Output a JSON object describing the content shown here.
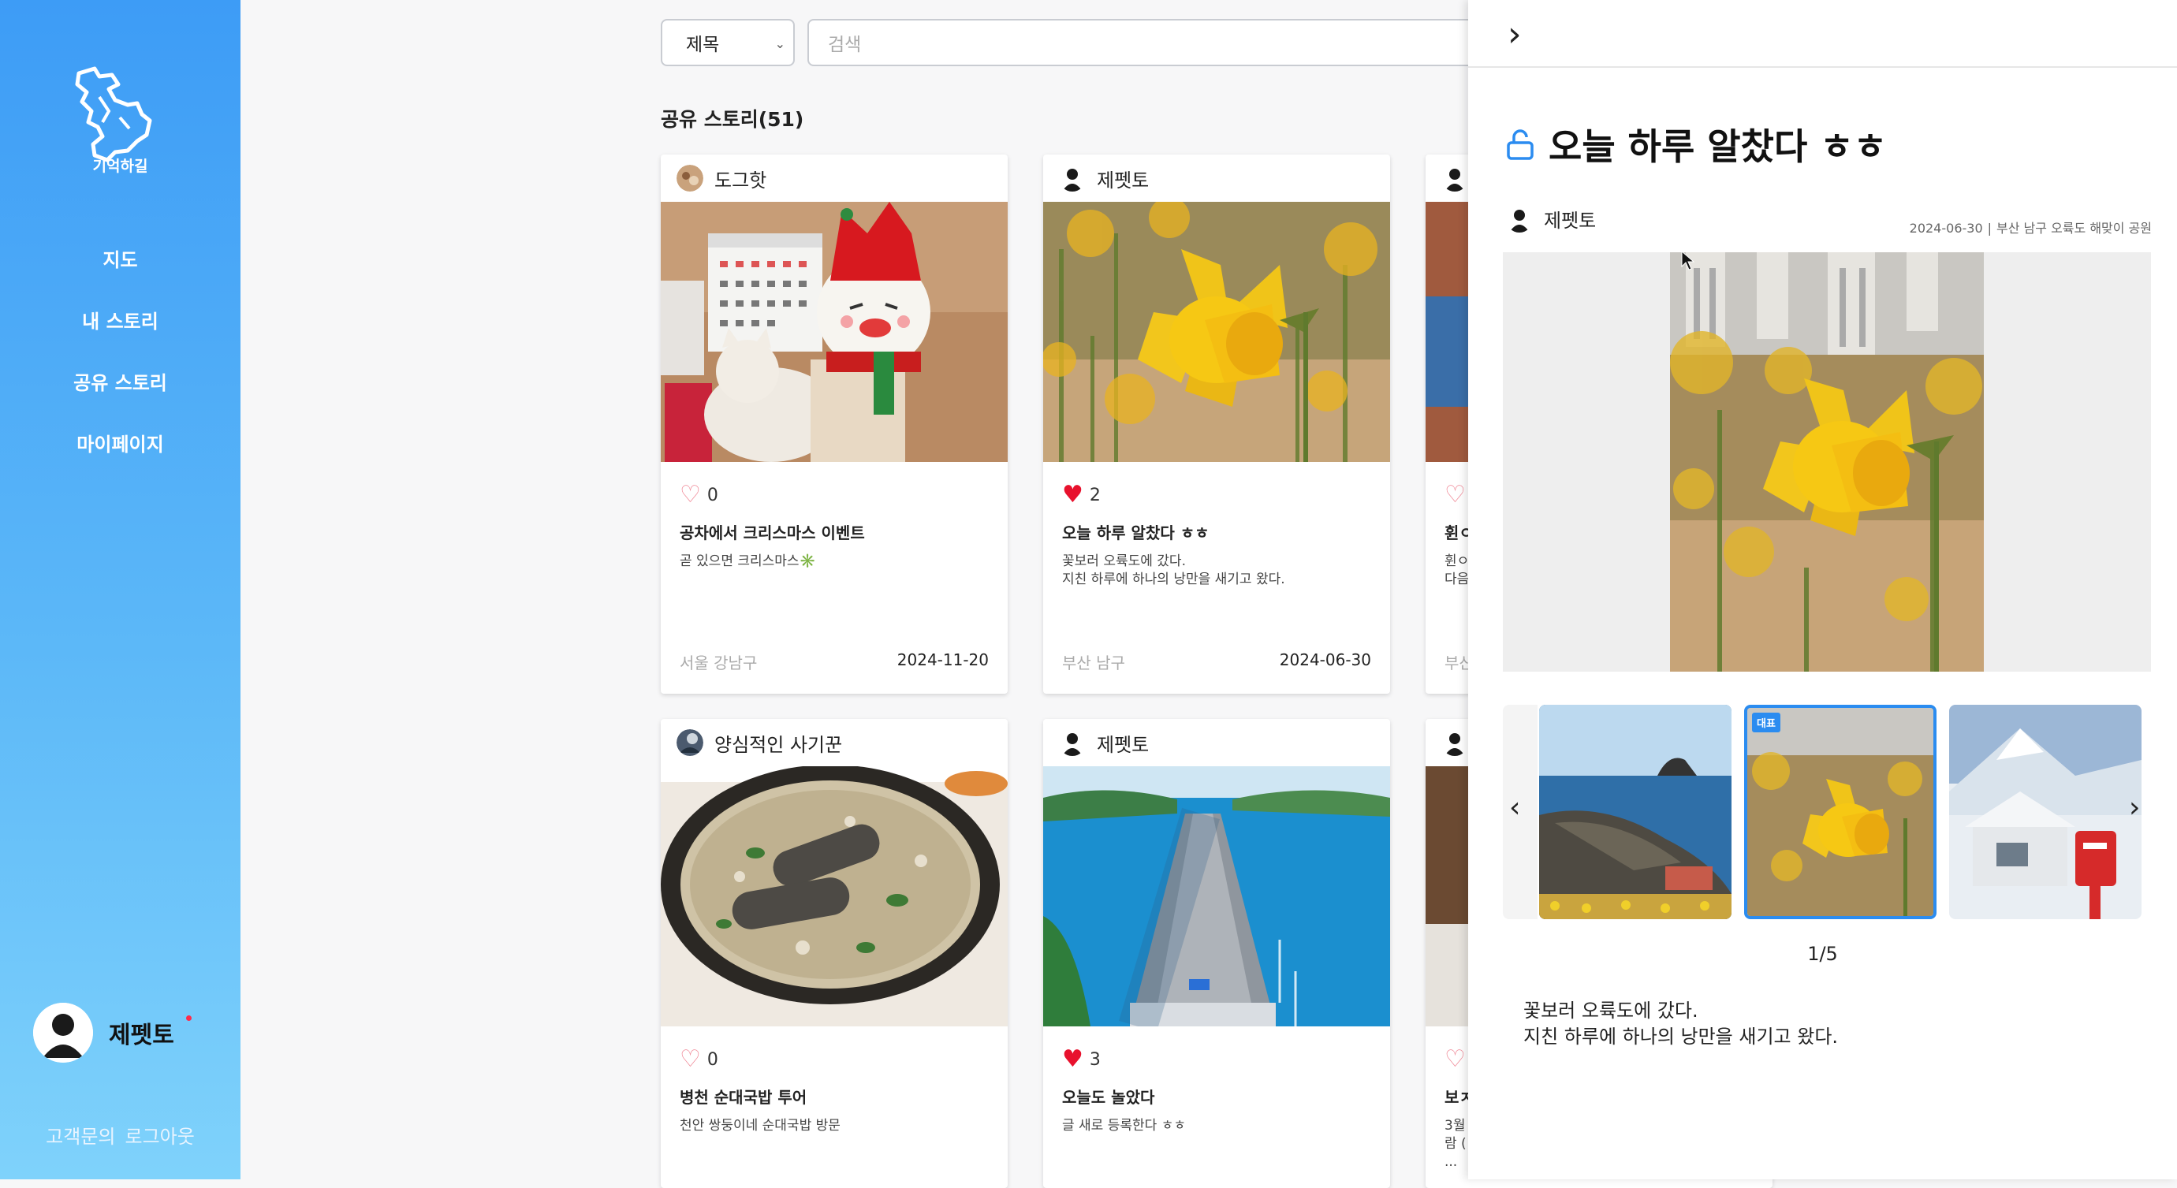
{
  "sidebar": {
    "logo_text": "기억하길",
    "nav": [
      "지도",
      "내 스토리",
      "공유 스토리",
      "마이페이지"
    ],
    "user_name": "제펫토",
    "customer_center": "고객문의",
    "logout": "로그아웃"
  },
  "search": {
    "select_value": "제목",
    "placeholder": "검색"
  },
  "list": {
    "title": "공유 스토리(51)"
  },
  "cards": [
    {
      "author": "도그핫",
      "likes": "0",
      "liked": false,
      "title": "공차에서 크리스마스 이벤트",
      "desc": "곧 있으면 크리스마스✳️",
      "location": "서울 강남구",
      "date": "2024-11-20"
    },
    {
      "author": "제펫토",
      "likes": "2",
      "liked": true,
      "title": "오늘 하루 알찼다 ㅎㅎ",
      "desc": "꽃보러 오륙도에 갔다.\n지친 하루에 하나의 낭만을 새기고 왔다.",
      "location": "부산 남구",
      "date": "2024-06-30"
    },
    {
      "author": "양심적인 사기꾼",
      "likes": "0",
      "liked": false,
      "title": "병천 순대국밥 투어",
      "desc": "천안 쌍둥이네 순대국밥 방문",
      "location": "",
      "date": ""
    },
    {
      "author": "제펫토",
      "likes": "3",
      "liked": true,
      "title": "오늘도 놀았다",
      "desc": "글 새로 등록한다 ㅎㅎ",
      "location": "",
      "date": ""
    }
  ],
  "partial_cards": {
    "top_title": "휜ㅇ",
    "top_lines": [
      "휜ㅇ",
      "다음"
    ],
    "top_loc": "부산",
    "bottom_title": "보ㅈ",
    "bottom_lines": [
      "3월",
      "람 (",
      "..."
    ]
  },
  "detail": {
    "title": "오늘 하루 알찼다 ㅎㅎ",
    "author": "제펫토",
    "date": "2024-06-30",
    "place": "부산 남구 오륙도 해맞이 공원",
    "badge": "대표",
    "page": "1/5",
    "text": "꽃보러 오륙도에 갔다.\n지친 하루에 하나의 낭만을 새기고 왔다."
  },
  "colors": {
    "sidebar_top": "#3d9cf6",
    "sidebar_bottom": "#7fd2fb",
    "accent": "#2b8cf0",
    "heart_liked": "#e8112d"
  },
  "icons": [
    "logo-map-icon",
    "lock-open-icon",
    "chevron-right-icon",
    "chevron-left-icon",
    "heart-icon",
    "avatar-icon"
  ]
}
